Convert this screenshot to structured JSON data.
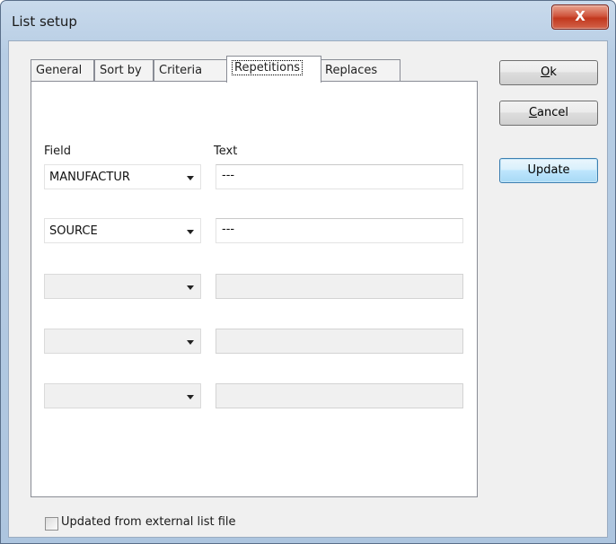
{
  "window": {
    "title": "List setup",
    "close_glyph": "X"
  },
  "tabs": [
    {
      "label": "General",
      "active": false
    },
    {
      "label": "Sort by",
      "active": false
    },
    {
      "label": "Criteria",
      "active": false
    },
    {
      "label": "Repetitions",
      "active": true
    },
    {
      "label": "Replaces",
      "active": false
    }
  ],
  "repetitions": {
    "field_header": "Field",
    "text_header": "Text",
    "rows": [
      {
        "field": "MANUFACTUR",
        "text": "---",
        "enabled": true
      },
      {
        "field": "SOURCE",
        "text": "---",
        "enabled": true
      },
      {
        "field": "",
        "text": "",
        "enabled": false
      },
      {
        "field": "",
        "text": "",
        "enabled": false
      },
      {
        "field": "",
        "text": "",
        "enabled": false
      }
    ]
  },
  "buttons": {
    "ok_accel": "O",
    "ok_rest": "k",
    "cancel_accel": "C",
    "cancel_rest": "ancel",
    "update": "Update"
  },
  "external_file": {
    "label": "Updated from external list file",
    "checked": false
  },
  "colors": {
    "close_button": "#c2381e",
    "focus_button": "#bee6fd"
  }
}
